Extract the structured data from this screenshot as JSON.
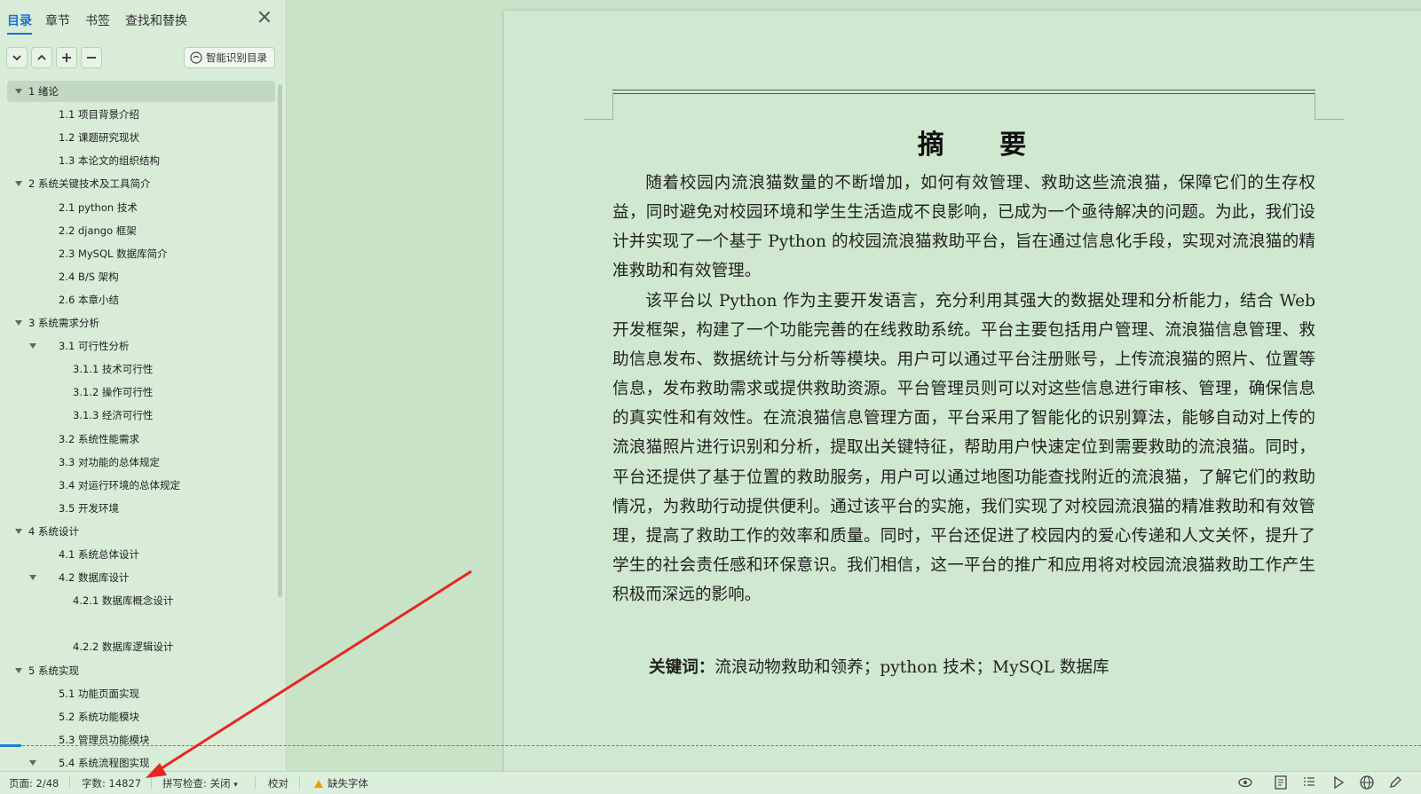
{
  "sidebar": {
    "tabs": [
      {
        "label": "目录",
        "active": true
      },
      {
        "label": "章节"
      },
      {
        "label": "书签"
      },
      {
        "label": "查找和替换"
      }
    ],
    "close_icon": "close-icon",
    "toolbar": {
      "expand_icon": "chevron-down-icon",
      "collapse_icon": "chevron-up-icon",
      "add_icon": "plus-icon",
      "remove_icon": "minus-icon",
      "smart_label": "智能识别目录"
    },
    "toc": [
      {
        "label": "1  绪论",
        "level": 0,
        "expand": true,
        "selected": true
      },
      {
        "label": "1.1 项目背景介绍",
        "level": 1
      },
      {
        "label": "1.2 课题研究现状",
        "level": 1
      },
      {
        "label": "1.3 本论文的组织结构",
        "level": 1
      },
      {
        "label": "2 系统关键技术及工具简介",
        "level": 0,
        "expand": true
      },
      {
        "label": "2.1 python 技术",
        "level": 1
      },
      {
        "label": "2.2 django 框架",
        "level": 1
      },
      {
        "label": "2.3 MySQL 数据库简介",
        "level": 1
      },
      {
        "label": "2.4 B/S 架构",
        "level": 1
      },
      {
        "label": "2.6  本章小结",
        "level": 1
      },
      {
        "label": "3 系统需求分析",
        "level": 0,
        "expand": true
      },
      {
        "label": "3.1  可行性分析",
        "level": 1,
        "expand": true
      },
      {
        "label": "3.1.1  技术可行性",
        "level": 2
      },
      {
        "label": "3.1.2  操作可行性",
        "level": 2
      },
      {
        "label": "3.1.3 经济可行性",
        "level": 2
      },
      {
        "label": "3.2 系统性能需求",
        "level": 1
      },
      {
        "label": "3.3 对功能的总体规定",
        "level": 1
      },
      {
        "label": "3.4 对运行环境的总体规定",
        "level": 1
      },
      {
        "label": "3.5 开发环境",
        "level": 1
      },
      {
        "label": "4 系统设计",
        "level": 0,
        "expand": true
      },
      {
        "label": "4.1 系统总体设计",
        "level": 1
      },
      {
        "label": "4.2 数据库设计",
        "level": 1,
        "expand": true
      },
      {
        "label": "4.2.1  数据库概念设计",
        "level": 2
      },
      {
        "label": "",
        "level": 2
      },
      {
        "label": "4.2.2  数据库逻辑设计",
        "level": 2
      },
      {
        "label": "5 系统实现",
        "level": 0,
        "expand": true
      },
      {
        "label": "5.1 功能页面实现",
        "level": 1
      },
      {
        "label": "5.2 系统功能模块",
        "level": 1
      },
      {
        "label": "5.3 管理员功能模块",
        "level": 1
      },
      {
        "label": "5.4 系统流程图实现",
        "level": 1,
        "expand": true
      }
    ]
  },
  "document": {
    "title": "摘    要",
    "paragraphs": [
      "随着校园内流浪猫数量的不断增加，如何有效管理、救助这些流浪猫，保障它们的生存权益，同时避免对校园环境和学生生活造成不良影响，已成为一个亟待解决的问题。为此，我们设计并实现了一个基于 Python 的校园流浪猫救助平台，旨在通过信息化手段，实现对流浪猫的精准救助和有效管理。",
      "该平台以 Python 作为主要开发语言，充分利用其强大的数据处理和分析能力，结合 Web 开发框架，构建了一个功能完善的在线救助系统。平台主要包括用户管理、流浪猫信息管理、救助信息发布、数据统计与分析等模块。用户可以通过平台注册账号，上传流浪猫的照片、位置等信息，发布救助需求或提供救助资源。平台管理员则可以对这些信息进行审核、管理，确保信息的真实性和有效性。在流浪猫信息管理方面，平台采用了智能化的识别算法，能够自动对上传的流浪猫照片进行识别和分析，提取出关键特征，帮助用户快速定位到需要救助的流浪猫。同时，平台还提供了基于位置的救助服务，用户可以通过地图功能查找附近的流浪猫，了解它们的救助情况，为救助行动提供便利。通过该平台的实施，我们实现了对校园流浪猫的精准救助和有效管理，提高了救助工作的效率和质量。同时，平台还促进了校园内的爱心传递和人文关怀，提升了学生的社会责任感和环保意识。我们相信，这一平台的推广和应用将对校园流浪猫救助工作产生积极而深远的影响。"
    ],
    "keywords_label": "关键词：",
    "keywords": "流浪动物救助和领养；python 技术；MySQL 数据库"
  },
  "statusbar": {
    "page": "页面: 2/48",
    "words": "字数: 14827",
    "spell": "拼写检查: 关闭",
    "proof": "校对",
    "missing_font": "缺失字体",
    "right_icons": [
      "eye-icon",
      "page-view-icon",
      "outline-view-icon",
      "play-icon",
      "globe-icon",
      "pen-icon"
    ]
  },
  "colors": {
    "accent": "#1d6fd6",
    "annotation_arrow": "#e8261f",
    "background": "#c9e3c9"
  }
}
